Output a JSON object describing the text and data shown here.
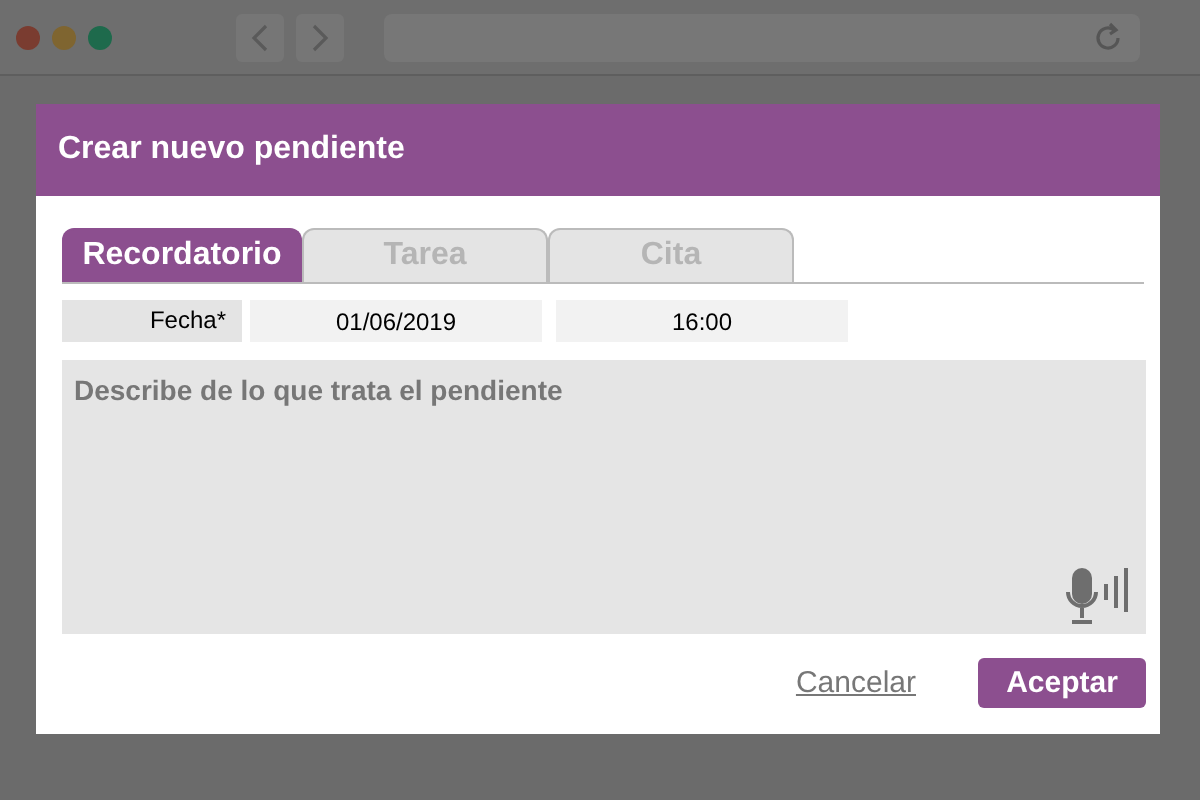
{
  "dialog": {
    "title": "Crear nuevo pendiente"
  },
  "tabs": [
    {
      "label": "Recordatorio",
      "selected": true
    },
    {
      "label": "Tarea",
      "selected": false
    },
    {
      "label": "Cita",
      "selected": false
    }
  ],
  "date_row": {
    "label": "Fecha*",
    "date": "01/06/2019",
    "time": "16:00"
  },
  "description": {
    "placeholder": "Describe de lo que trata el pendiente"
  },
  "buttons": {
    "cancel": "Cancelar",
    "accept": "Aceptar"
  }
}
